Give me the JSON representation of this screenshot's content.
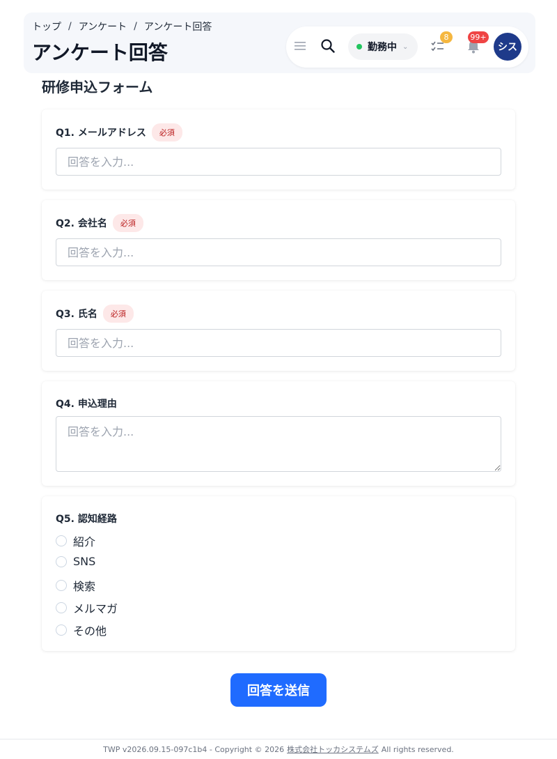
{
  "breadcrumb": {
    "items": [
      "トップ",
      "アンケート",
      "アンケート回答"
    ],
    "separator": "/"
  },
  "page_title": "アンケート回答",
  "toolbar": {
    "menu_icon": "hamburger-menu-icon",
    "search_icon": "search-icon",
    "status_label": "勤務中",
    "status_color": "#22c55e",
    "tasks_icon": "checklist-icon",
    "tasks_count": "8",
    "bell_icon": "bell-icon",
    "notifications_count": "99+",
    "avatar_text": "シス",
    "avatar_color": "#1e3a8a"
  },
  "form": {
    "title": "研修申込フォーム",
    "required_label": "必須",
    "placeholder": "回答を入力...",
    "questions": [
      {
        "label": "Q1. メールアドレス",
        "required": true,
        "type": "text",
        "value": ""
      },
      {
        "label": "Q2. 会社名",
        "required": true,
        "type": "text",
        "value": ""
      },
      {
        "label": "Q3. 氏名",
        "required": true,
        "type": "text",
        "value": ""
      },
      {
        "label": "Q4. 申込理由",
        "required": false,
        "type": "textarea",
        "value": ""
      },
      {
        "label": "Q5. 認知経路",
        "required": false,
        "type": "radio",
        "options": [
          "紹介",
          "SNS",
          "検索",
          "メルマガ",
          "その他"
        ],
        "selected": null
      }
    ],
    "submit_label": "回答を送信",
    "accent_color": "#1f6bff"
  },
  "footer": {
    "version_text": "TWP v2026.09.15-097c1b4 - Copyright © 2026",
    "company_link": "株式会社トッカシステムズ",
    "rights_text": "All rights reserved."
  }
}
